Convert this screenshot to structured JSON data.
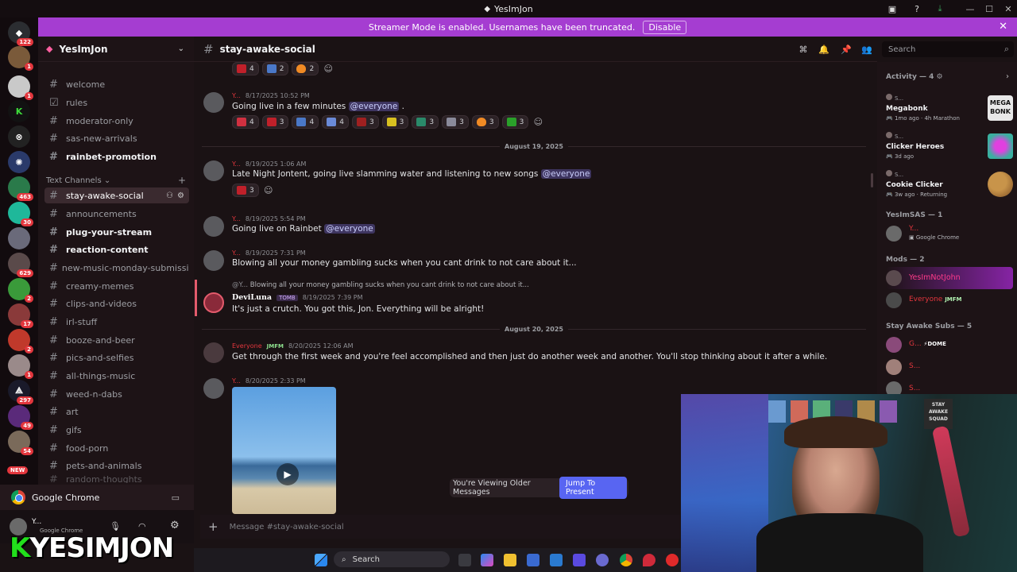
{
  "window": {
    "title": "YesImJon"
  },
  "banner": {
    "text": "Streamer Mode is enabled. Usernames have been truncated.",
    "button": "Disable",
    "close": "✕"
  },
  "rail": {
    "badges": [
      "122",
      "1",
      "1",
      "463",
      "30",
      "629",
      "2",
      "17",
      "2",
      "1",
      "297",
      "49",
      "54"
    ],
    "new_label": "NEW"
  },
  "guild": {
    "name": "YesImJon"
  },
  "channels": {
    "top": [
      "welcome",
      "rules",
      "moderator-only",
      "sas-new-arrivals",
      "rainbet-promotion"
    ],
    "category": "Text Channels",
    "list": [
      "stay-awake-social",
      "announcements",
      "plug-your-stream",
      "reaction-content",
      "new-music-monday-submissio...",
      "creamy-memes",
      "clips-and-videos",
      "irl-stuff",
      "booze-and-beer",
      "pics-and-selfies",
      "all-things-music",
      "weed-n-dabs",
      "art",
      "gifs",
      "food-porn",
      "pets-and-animals",
      "random-thoughts"
    ]
  },
  "activity_panel": {
    "app": "Google Chrome"
  },
  "user_panel": {
    "name": "Y...",
    "status": "Google Chrome"
  },
  "overlay_logo": {
    "k": "K",
    "rest": "YESIMJON"
  },
  "chat": {
    "channel": "stay-awake-social",
    "composer_placeholder": "Message #stay-awake-social",
    "older_notice": "You're Viewing Older Messages",
    "jump_button": "Jump To Present",
    "dividers": [
      "August 19, 2025",
      "August 20, 2025"
    ],
    "messages": [
      {
        "author": "Y...",
        "time": "8/17/2025 10:52 PM",
        "text": "Going live in a few minutes",
        "mention": "@everyone",
        "suffix": " ."
      },
      {
        "author": "Y...",
        "time": "8/19/2025 1:06 AM",
        "text": "Late Night Jontent, going live slamming water and listening to new songs",
        "mention": "@everyone",
        "suffix": ""
      },
      {
        "author": "Y...",
        "time": "8/19/2025 5:54 PM",
        "text": "Going live on Rainbet",
        "mention": "@everyone",
        "suffix": ""
      },
      {
        "author": "Y...",
        "time": "8/19/2025 7:31 PM",
        "text": "Blowing all your money gambling sucks when you cant drink to not care about it...",
        "mention": "",
        "suffix": ""
      },
      {
        "author": "DeviLuna",
        "tag": "TOMB",
        "time": "8/19/2025 7:39 PM",
        "reply_author": "@Y...",
        "reply": "Blowing all your money gambling sucks when you cant drink to not care about it...",
        "text": "It's just a crutch. You got this, Jon. Everything will be alright!",
        "mention": "",
        "suffix": ""
      },
      {
        "author": "Everyone",
        "tag": "JMFM",
        "time": "8/20/2025 12:06 AM",
        "text": "Get through the first week and you're feel accomplished and then just do another week and another. You'll stop thinking about it after a while.",
        "mention": "",
        "suffix": ""
      },
      {
        "author": "Y...",
        "time": "8/20/2025 2:33 PM",
        "text": "",
        "mention": "",
        "suffix": ""
      }
    ],
    "reactions_top": [
      "4",
      "2",
      "2"
    ],
    "reactions_msg1": [
      "4",
      "3",
      "4",
      "4",
      "3",
      "3",
      "3",
      "3",
      "3",
      "3"
    ],
    "reactions_msg2": [
      "3"
    ]
  },
  "members": {
    "search_placeholder": "Search",
    "activity_header": "Activity — 4",
    "activities": [
      {
        "user": "S...",
        "game": "Megabonk",
        "time": "1mo ago",
        "extra": "4h Marathon"
      },
      {
        "user": "S...",
        "game": "Clicker Heroes",
        "time": "3d ago",
        "extra": ""
      },
      {
        "user": "S...",
        "game": "Cookie Clicker",
        "time": "3w ago",
        "extra": "Returning"
      }
    ],
    "art_labels": [
      "MEGA",
      "BONK"
    ],
    "groups": [
      {
        "title": "YesImSAS — 1",
        "members": [
          {
            "name": "Y...",
            "status": "Google Chrome"
          }
        ]
      },
      {
        "title": "Mods — 2",
        "members": [
          {
            "name": "YesImNotJohn",
            "status": ""
          },
          {
            "name": "Everyone",
            "status": "JMFM"
          }
        ]
      },
      {
        "title": "Stay Awake Subs — 5",
        "members": [
          {
            "name": "G...",
            "status": "DOME"
          },
          {
            "name": "S...",
            "status": ""
          },
          {
            "name": "S...",
            "status": ""
          }
        ]
      }
    ]
  },
  "webcam_sign": [
    "STAY",
    "AWAKE",
    "SQUAD"
  ],
  "taskbar": {
    "search": "Search"
  },
  "colors": {
    "accent": "#a53dd1",
    "blurple": "#5865f2",
    "mention_bg": "#3e3560",
    "red_name": "#e3363d"
  }
}
